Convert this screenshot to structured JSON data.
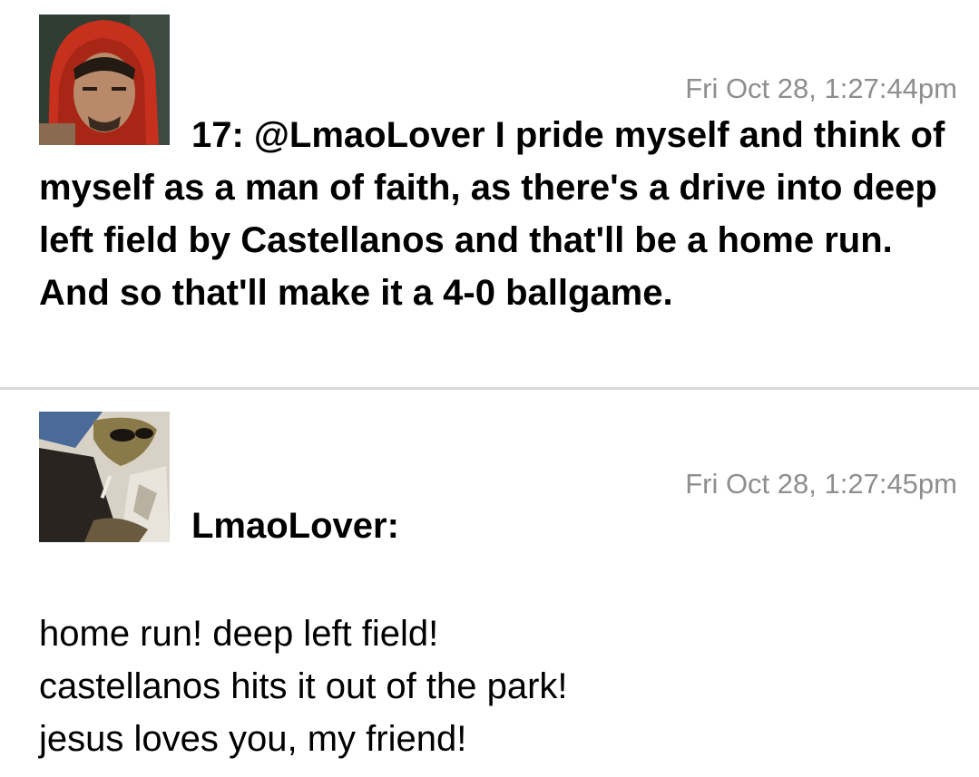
{
  "posts": [
    {
      "timestamp": "Fri Oct 28, 1:27:44pm",
      "message": "17: @LmaoLover I pride myself and think of myself as a man of faith, as there's a drive into deep left field by Castellanos and that'll be a home run. And so that'll make it a 4-0 ballgame."
    },
    {
      "timestamp": "Fri Oct 28, 1:27:45pm",
      "author": "LmaoLover:",
      "lines": [
        "home run! deep left field!",
        "castellanos hits it out of the park!",
        "jesus loves you, my friend!"
      ]
    }
  ],
  "colors": {
    "timestamp": "#8e8e8e",
    "divider": "#d9d9d9",
    "text": "#000000"
  }
}
